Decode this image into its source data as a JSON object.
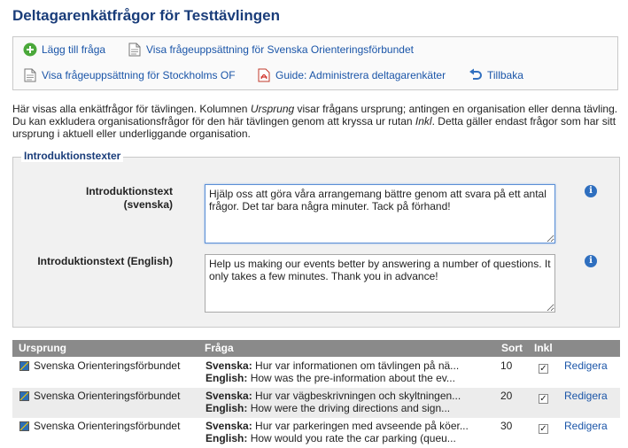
{
  "page": {
    "title": "Deltagarenkätfrågor för Testtävlingen"
  },
  "actions": {
    "add_question": "Lägg till fråga",
    "view_sof": "Visa frågeuppsättning för Svenska Orienteringsförbundet",
    "view_stockholm": "Visa frågeuppsättning för Stockholms OF",
    "guide": "Guide: Administrera deltagarenkäter",
    "back": "Tillbaka"
  },
  "intro": {
    "part1": "Här visas alla enkätfrågor för tävlingen. Kolumnen ",
    "em1": "Ursprung",
    "part2": " visar frågans ursprung; antingen en organisation eller denna tävling. Du kan exkludera organisationsfrågor för den här tävlingen genom att kryssa ur rutan ",
    "em2": "Inkl",
    "part3": ". Detta gäller endast frågor som har sitt ursprung i aktuell eller underliggande organisation."
  },
  "intro_texts": {
    "legend": "Introduktionstexter",
    "sv_label_line1": "Introduktionstext",
    "sv_label_line2": "(svenska)",
    "sv_value": "Hjälp oss att göra våra arrangemang bättre genom att svara på ett antal frågor. Det tar bara några minuter. Tack på förhand!",
    "en_label": "Introduktionstext (English)",
    "en_value": "Help us making our events better by answering a number of questions. It only takes a few minutes. Thank you in advance!",
    "info_glyph": "i"
  },
  "table": {
    "headers": {
      "origin": "Ursprung",
      "question": "Fråga",
      "sort": "Sort",
      "incl": "Inkl"
    },
    "sv_prefix": "Svenska:",
    "en_prefix": "English:",
    "edit_label": "Redigera",
    "rows": [
      {
        "origin": "Svenska Orienteringsförbundet",
        "sv": "Hur var informationen om tävlingen på nä...",
        "en": "How was the pre-information about the ev...",
        "sort": "10",
        "included": true
      },
      {
        "origin": "Svenska Orienteringsförbundet",
        "sv": "Hur var vägbeskrivningen och skyltningen...",
        "en": "How were the driving directions and sign...",
        "sort": "20",
        "included": true
      },
      {
        "origin": "Svenska Orienteringsförbundet",
        "sv": "Hur var parkeringen med avseende på köer...",
        "en": "How would you rate the car parking (queu...",
        "sort": "30",
        "included": true
      }
    ]
  },
  "colors": {
    "title": "#1a3d7a",
    "link": "#1a55a8",
    "header_bg": "#8a8a8a",
    "row_alt": "#ececec"
  }
}
